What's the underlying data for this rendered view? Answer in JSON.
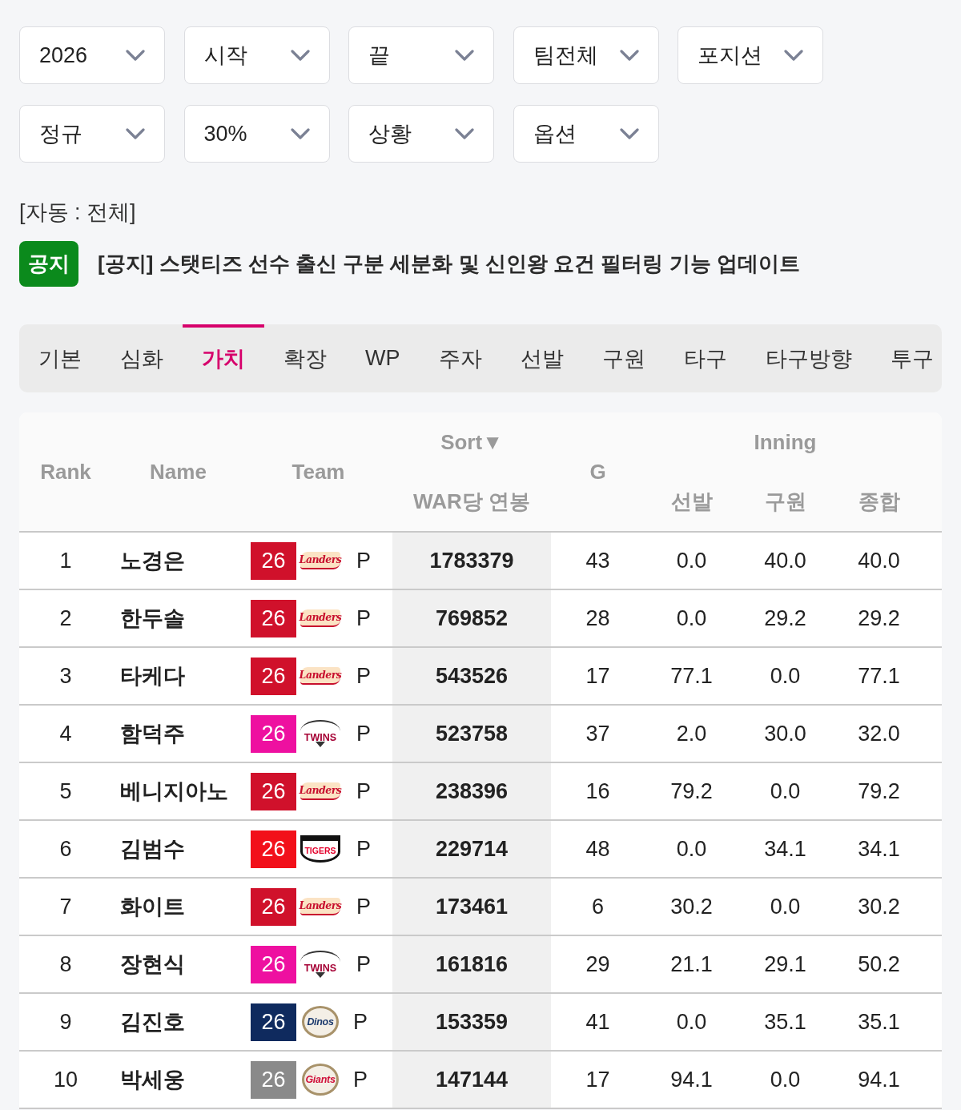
{
  "filter_rows": [
    [
      {
        "label": "2026"
      },
      {
        "label": "시작"
      },
      {
        "label": "끝"
      },
      {
        "label": "팀전체"
      },
      {
        "label": "포지션"
      }
    ],
    [
      {
        "label": "정규"
      },
      {
        "label": "30%"
      },
      {
        "label": "상황"
      },
      {
        "label": "옵션"
      }
    ]
  ],
  "mode_label": "[자동 : 전체]",
  "notice": {
    "badge": "공지",
    "title": "[공지] 스탯티즈 선수 출신 구분 세분화 및 신인왕 요건 필터링 기능 업데이트"
  },
  "tabs": [
    {
      "label": "기본",
      "selected": false
    },
    {
      "label": "심화",
      "selected": false
    },
    {
      "label": "가치",
      "selected": true
    },
    {
      "label": "확장",
      "selected": false
    },
    {
      "label": "WP",
      "selected": false
    },
    {
      "label": "주자",
      "selected": false
    },
    {
      "label": "선발",
      "selected": false
    },
    {
      "label": "구원",
      "selected": false
    },
    {
      "label": "타구",
      "selected": false
    },
    {
      "label": "타구방향",
      "selected": false
    },
    {
      "label": "투구",
      "selected": false
    }
  ],
  "table": {
    "header": {
      "rank": "Rank",
      "name": "Name",
      "team": "Team",
      "sort": "Sort▼",
      "value": "WAR당 연봉",
      "games": "G",
      "group": "Inning",
      "sub": [
        "선발",
        "구원",
        "종합"
      ]
    },
    "rows": [
      {
        "rank": "1",
        "name": "노경은",
        "year": "26",
        "color": "#d0112b",
        "logo": {
          "kind": "banner",
          "text": "Landers",
          "color": "#c8102e"
        },
        "position": "P",
        "value": "1783379",
        "g": "43",
        "innings": [
          "0.0",
          "40.0",
          "40.0"
        ]
      },
      {
        "rank": "2",
        "name": "한두솔",
        "year": "26",
        "color": "#d0112b",
        "logo": {
          "kind": "banner",
          "text": "Landers",
          "color": "#c8102e"
        },
        "position": "P",
        "value": "769852",
        "g": "28",
        "innings": [
          "0.0",
          "29.2",
          "29.2"
        ]
      },
      {
        "rank": "3",
        "name": "타케다",
        "year": "26",
        "color": "#d0112b",
        "logo": {
          "kind": "banner",
          "text": "Landers",
          "color": "#c8102e"
        },
        "position": "P",
        "value": "543526",
        "g": "17",
        "innings": [
          "77.1",
          "0.0",
          "77.1"
        ]
      },
      {
        "rank": "4",
        "name": "함덕주",
        "year": "26",
        "color": "#ee10a0",
        "logo": {
          "kind": "arch",
          "text": "TWINS",
          "color": "#a50034"
        },
        "position": "P",
        "value": "523758",
        "g": "37",
        "innings": [
          "2.0",
          "30.0",
          "32.0"
        ]
      },
      {
        "rank": "5",
        "name": "베니지아노",
        "year": "26",
        "color": "#d0112b",
        "logo": {
          "kind": "banner",
          "text": "Landers",
          "color": "#c8102e"
        },
        "position": "P",
        "value": "238396",
        "g": "16",
        "innings": [
          "79.2",
          "0.0",
          "79.2"
        ]
      },
      {
        "rank": "6",
        "name": "김범수",
        "year": "26",
        "color": "#f2101a",
        "logo": {
          "kind": "shield",
          "text": "TIGERS",
          "color": "#e4002b"
        },
        "position": "P",
        "value": "229714",
        "g": "48",
        "innings": [
          "0.0",
          "34.1",
          "34.1"
        ]
      },
      {
        "rank": "7",
        "name": "화이트",
        "year": "26",
        "color": "#d0112b",
        "logo": {
          "kind": "banner",
          "text": "Landers",
          "color": "#c8102e"
        },
        "position": "P",
        "value": "173461",
        "g": "6",
        "innings": [
          "30.2",
          "0.0",
          "30.2"
        ]
      },
      {
        "rank": "8",
        "name": "장현식",
        "year": "26",
        "color": "#ee10a0",
        "logo": {
          "kind": "arch",
          "text": "TWINS",
          "color": "#a50034"
        },
        "position": "P",
        "value": "161816",
        "g": "29",
        "innings": [
          "21.1",
          "29.1",
          "50.2"
        ]
      },
      {
        "rank": "9",
        "name": "김진호",
        "year": "26",
        "color": "#0f2a5e",
        "logo": {
          "kind": "roundel",
          "text": "Dinos",
          "color": "#1d3b6e"
        },
        "position": "P",
        "value": "153359",
        "g": "41",
        "innings": [
          "0.0",
          "35.1",
          "35.1"
        ]
      },
      {
        "rank": "10",
        "name": "박세웅",
        "year": "26",
        "color": "#8a8a8a",
        "logo": {
          "kind": "roundel",
          "text": "Giants",
          "color": "#d0103a"
        },
        "position": "P",
        "value": "147144",
        "g": "17",
        "innings": [
          "94.1",
          "0.0",
          "94.1"
        ]
      }
    ]
  }
}
